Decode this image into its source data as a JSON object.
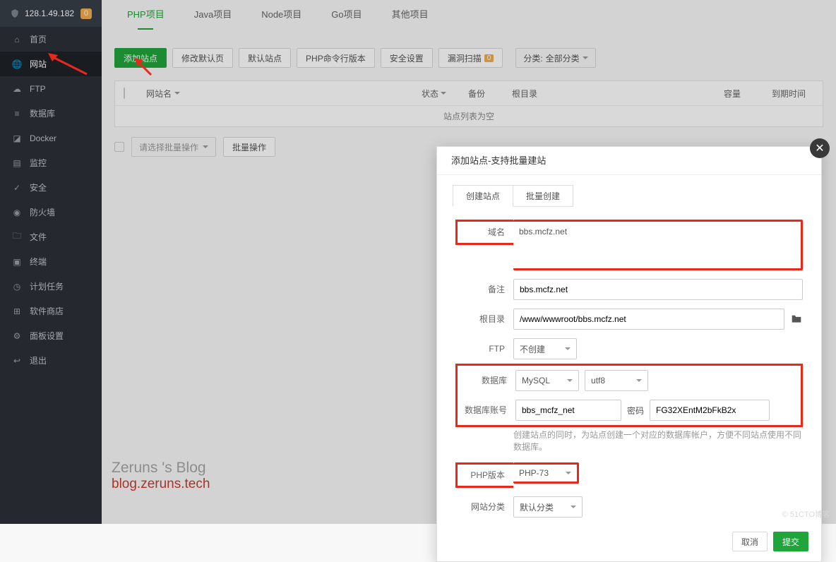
{
  "header": {
    "ip": "128.1.49.182",
    "notice_count": "0"
  },
  "sidebar": {
    "items": [
      {
        "label": "首页",
        "icon": "home",
        "id": "home"
      },
      {
        "label": "网站",
        "icon": "globe",
        "id": "site",
        "active": true
      },
      {
        "label": "FTP",
        "icon": "cloud",
        "id": "ftp"
      },
      {
        "label": "数据库",
        "icon": "database",
        "id": "db"
      },
      {
        "label": "Docker",
        "icon": "docker",
        "id": "docker"
      },
      {
        "label": "监控",
        "icon": "monitor",
        "id": "monitor"
      },
      {
        "label": "安全",
        "icon": "shield",
        "id": "security"
      },
      {
        "label": "防火墙",
        "icon": "firewall",
        "id": "firewall"
      },
      {
        "label": "文件",
        "icon": "folder",
        "id": "files"
      },
      {
        "label": "终端",
        "icon": "terminal",
        "id": "terminal"
      },
      {
        "label": "计划任务",
        "icon": "clock",
        "id": "cron"
      },
      {
        "label": "软件商店",
        "icon": "store",
        "id": "store"
      },
      {
        "label": "面板设置",
        "icon": "gear",
        "id": "settings"
      },
      {
        "label": "退出",
        "icon": "exit",
        "id": "logout"
      }
    ]
  },
  "tabs": [
    {
      "label": "PHP项目",
      "active": true
    },
    {
      "label": "Java项目"
    },
    {
      "label": "Node项目"
    },
    {
      "label": "Go项目"
    },
    {
      "label": "其他项目"
    }
  ],
  "toolbar": {
    "add_site": "添加站点",
    "edit_default": "修改默认页",
    "default_site": "默认站点",
    "php_cli": "PHP命令行版本",
    "security": "安全设置",
    "scan": "漏洞扫描",
    "scan_badge": "0",
    "category_label": "分类:",
    "category_value": "全部分类"
  },
  "table": {
    "headers": {
      "name": "网站名",
      "status": "状态",
      "backup": "备份",
      "root": "根目录",
      "quota": "容量",
      "expiry": "到期时间"
    },
    "empty_text": "站点列表为空"
  },
  "batch": {
    "placeholder": "请选择批量操作",
    "action": "批量操作"
  },
  "dialog": {
    "title": "添加站点-支持批量建站",
    "tab_create": "创建站点",
    "tab_batch": "批量创建",
    "labels": {
      "domain": "域名",
      "remark": "备注",
      "root": "根目录",
      "ftp": "FTP",
      "db": "数据库",
      "db_user": "数据库账号",
      "db_pwd": "密码",
      "php": "PHP版本",
      "category": "网站分类"
    },
    "values": {
      "domain": "bbs.mcfz.net",
      "remark": "bbs.mcfz.net",
      "root": "/www/wwwroot/bbs.mcfz.net",
      "ftp": "不创建",
      "db": "MySQL",
      "charset": "utf8",
      "db_user": "bbs_mcfz_net",
      "db_pwd": "FG32XEntM2bFkB2x",
      "php": "PHP-73",
      "category": "默认分类"
    },
    "tip": "创建站点的同时，为站点创建一个对应的数据库帐户，方便不同站点使用不同数据库。",
    "cancel": "取消",
    "submit": "提交"
  },
  "watermark": {
    "l1": "Zeruns 's Blog",
    "l2": "blog.zeruns.tech"
  },
  "corner_wm": "© 51CTO博客"
}
